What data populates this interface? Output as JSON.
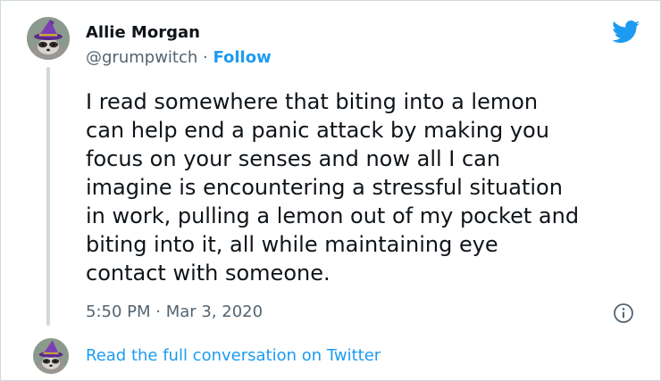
{
  "tweet": {
    "author_name": "Allie Morgan",
    "handle": "@grumpwitch",
    "separator": " · ",
    "follow_label": "Follow",
    "text": "I read somewhere that biting into a lemon\ncan help end a panic attack by making you\nfocus on your senses and now all I can\nimagine is encountering a stressful situation\nin work, pulling a lemon out of my pocket and\nbiting into it, all while maintaining eye\ncontact with someone.",
    "timestamp": "5:50 PM · Mar 3, 2020"
  },
  "footer": {
    "read_more_label": "Read the full conversation on Twitter"
  },
  "icons": {
    "brand": "twitter-bird-icon",
    "info": "info-icon",
    "avatar": "raccoon-witch-avatar"
  },
  "colors": {
    "accent": "#1d9bf0",
    "text": "#0f1419",
    "muted": "#536471",
    "border": "#cfd9de"
  }
}
